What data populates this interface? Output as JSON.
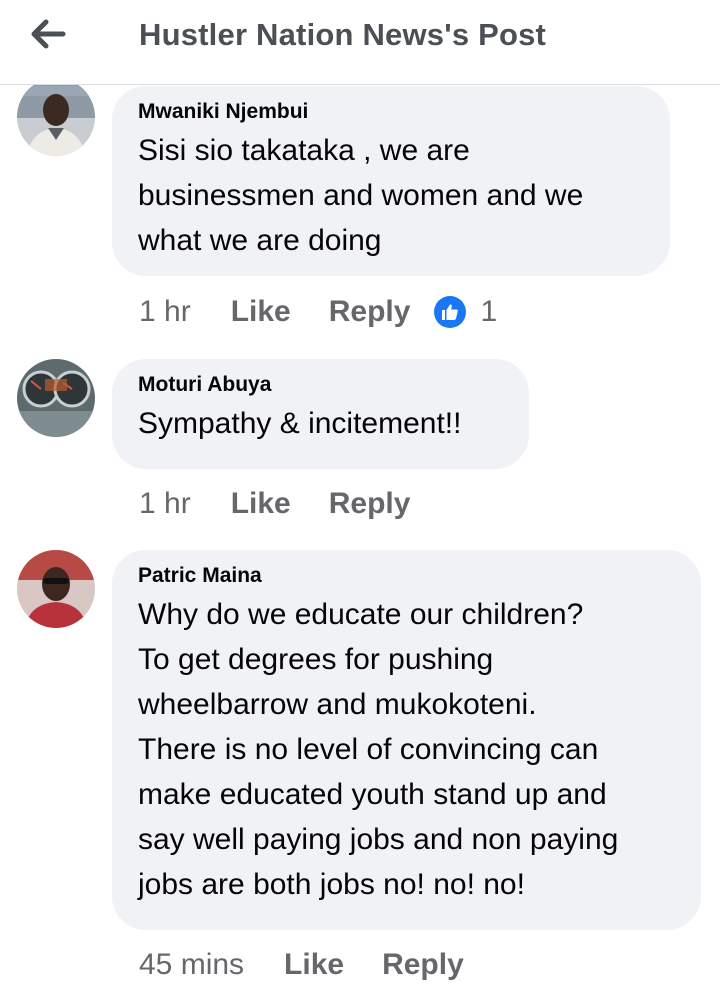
{
  "header": {
    "title": "Hustler Nation News's Post",
    "back_icon": "arrow-left-icon"
  },
  "colors": {
    "bubble": "#f0f2f5",
    "meta_text": "#65676b",
    "header_text": "#4b4f56",
    "like_blue": "#1877f2"
  },
  "comments": [
    {
      "author": "Mwaniki Njembui",
      "lines": [
        "Sisi sio takataka , we are",
        "businessmen and women and we",
        "what we are doing"
      ],
      "time": "1 hr",
      "like_label": "Like",
      "reply_label": "Reply",
      "reaction_icon": "thumbs-up-icon",
      "reaction_count": "1"
    },
    {
      "author": "Moturi Abuya",
      "lines": [
        "Sympathy & incitement!!"
      ],
      "time": "1 hr",
      "like_label": "Like",
      "reply_label": "Reply"
    },
    {
      "author": "Patric Maina",
      "lines": [
        "Why do we educate our children?",
        "To get degrees for pushing",
        "wheelbarrow and mukokoteni.",
        "There is no level of convincing can",
        "make educated youth stand up and",
        "say well paying jobs and non paying",
        "jobs are both jobs no! no! no!"
      ],
      "time": "45 mins",
      "like_label": "Like",
      "reply_label": "Reply"
    }
  ]
}
